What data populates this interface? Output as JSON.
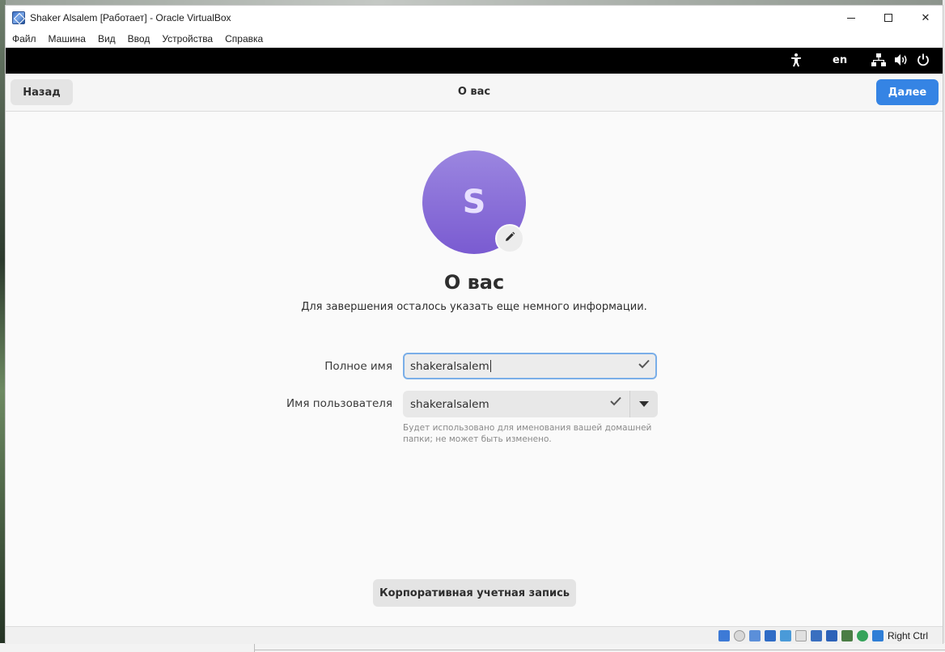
{
  "window": {
    "title": "Shaker Alsalem [Работает] - Oracle VirtualBox",
    "minimize": "",
    "close_glyph": "✕"
  },
  "menu": [
    "Файл",
    "Машина",
    "Вид",
    "Ввод",
    "Устройства",
    "Справка"
  ],
  "topbar": {
    "accessibility_icon": "accessibility-icon",
    "language": "en",
    "network_icon": "network-icon",
    "volume_icon": "volume-icon",
    "power_icon": "power-icon"
  },
  "header": {
    "back_label": "Назад",
    "title": "О вас",
    "next_label": "Далее"
  },
  "avatar": {
    "letter": "S",
    "edit_icon": "pencil-icon"
  },
  "content": {
    "title": "О вас",
    "subtitle": "Для завершения осталось указать еще немного информации."
  },
  "form": {
    "full_name_label": "Полное имя",
    "full_name_value": "shakeralsalem",
    "username_label": "Имя пользователя",
    "username_value": "shakeralsalem",
    "hint": "Будет использовано для именования вашей домашней папки; не может быть изменено."
  },
  "enterprise_label": "Корпоративная учетная запись",
  "statusbar": {
    "host_key": "Right Ctrl"
  },
  "colors": {
    "accent": "#3584e4",
    "avatar": "#8a6fd8"
  }
}
